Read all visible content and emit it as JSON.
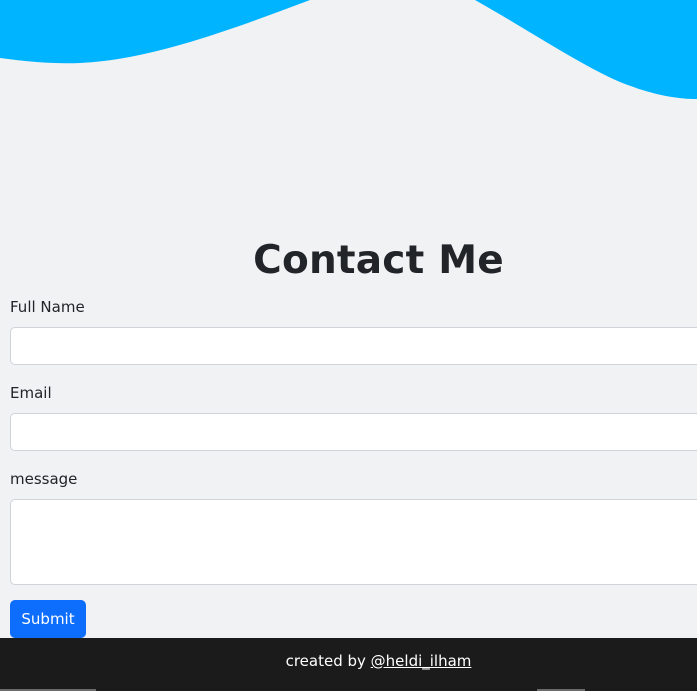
{
  "theme": {
    "wave_color": "#00b4ff",
    "background": "#f1f2f4",
    "primary_button": "#0d6efd",
    "footer_background": "#1b1b1b"
  },
  "contact": {
    "title": "Contact Me"
  },
  "form": {
    "full_name": {
      "label": "Full Name",
      "value": "",
      "placeholder": ""
    },
    "email": {
      "label": "Email",
      "value": "",
      "placeholder": ""
    },
    "message": {
      "label": "message",
      "value": "",
      "placeholder": ""
    },
    "submit_label": "Submit"
  },
  "footer": {
    "prefix": "created by",
    "author_link": "@heldi_ilham"
  }
}
